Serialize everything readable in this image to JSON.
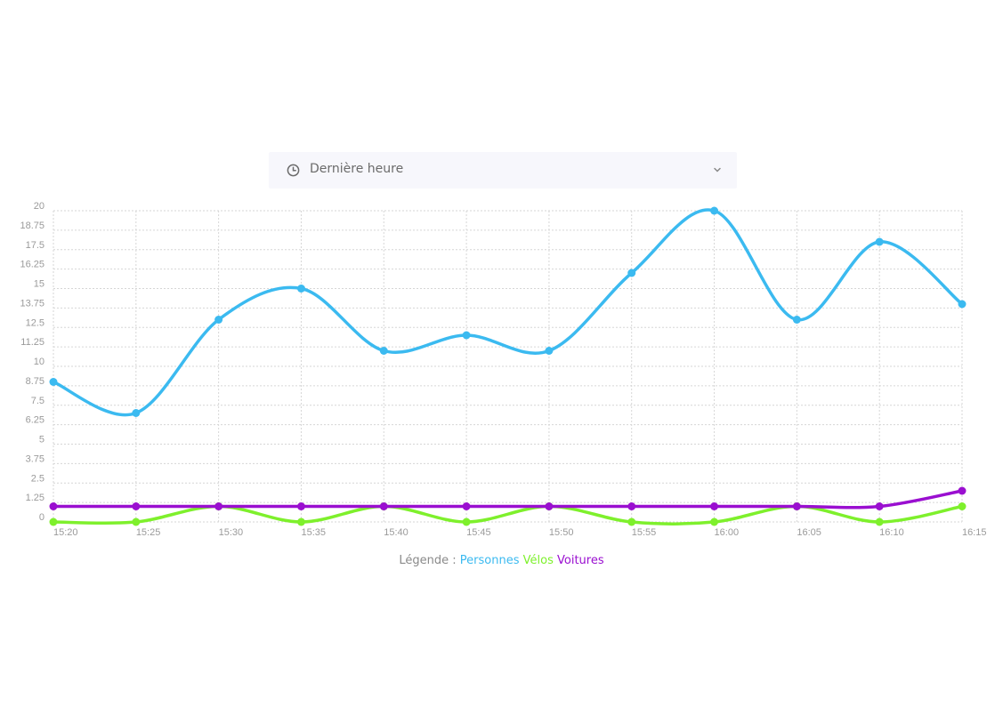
{
  "filter": {
    "selected": "Dernière heure",
    "icon": "clock-icon",
    "chevron_icon": "chevron-down-icon"
  },
  "legend": {
    "prefix": "Légende :",
    "items": [
      {
        "label": "Personnes",
        "color": "#3bbaf0"
      },
      {
        "label": "Vélos",
        "color": "#7ef02c"
      },
      {
        "label": "Voitures",
        "color": "#9a0fd0"
      }
    ]
  },
  "chart_data": {
    "type": "line",
    "x": [
      "15:20",
      "15:25",
      "15:30",
      "15:35",
      "15:40",
      "15:45",
      "15:50",
      "15:55",
      "16:00",
      "16:05",
      "16:10",
      "16:15"
    ],
    "ylim": [
      0,
      20
    ],
    "yticks": [
      "0",
      "1.25",
      "2.5",
      "3.75",
      "5",
      "6.25",
      "7.5",
      "8.75",
      "10",
      "11.25",
      "12.5",
      "13.75",
      "15",
      "16.25",
      "17.5",
      "18.75",
      "20"
    ],
    "grid": true,
    "series": [
      {
        "name": "Personnes",
        "color": "#3bbaf0",
        "values": [
          9,
          7,
          13,
          15,
          11,
          12,
          11,
          16,
          20,
          13,
          18,
          14
        ]
      },
      {
        "name": "Vélos",
        "color": "#7ef02c",
        "values": [
          0,
          0,
          1,
          0,
          1,
          0,
          1,
          0,
          0,
          1,
          0,
          1
        ]
      },
      {
        "name": "Voitures",
        "color": "#9a0fd0",
        "values": [
          1,
          1,
          1,
          1,
          1,
          1,
          1,
          1,
          1,
          1,
          1,
          2
        ]
      }
    ]
  }
}
